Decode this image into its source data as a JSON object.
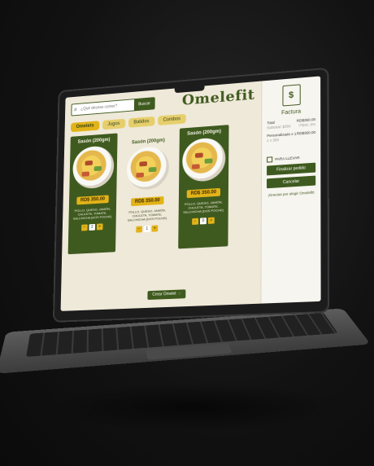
{
  "app": {
    "brand": "Omelefit"
  },
  "search": {
    "placeholder": "¿Qué deseas comer?",
    "button_label": "Buscar"
  },
  "tabs": [
    {
      "label": "Omelets",
      "active": true
    },
    {
      "label": "Jugos",
      "active": false
    },
    {
      "label": "Batidos",
      "active": false
    },
    {
      "label": "Combos",
      "active": false
    }
  ],
  "cards": [
    {
      "title": "Sasón (200gm)",
      "price": "RD$ 350.00",
      "desc": "POLLO, QUESO, JAMÓN, CHULETA, TOMATE, SALCHICHA (DOS POCHE)",
      "qty": "2"
    },
    {
      "title": "Sasón (200gm)",
      "price": "RD$ 350.00",
      "desc": "POLLO, QUESO, JAMÓN, CHULETA, TOMATE, SALCHICHA (DOS POCHE)",
      "qty": "1"
    },
    {
      "title": "Sasón (200gm)",
      "price": "RD$ 350.00",
      "desc": "POLLO, QUESO, JAMÓN, CHULETA, TOMATE, SALCHICHA (DOS POCHE)",
      "qty": "0"
    }
  ],
  "create_button": {
    "label": "Crear Omelet"
  },
  "invoice": {
    "title": "Factura",
    "total_label": "Total",
    "total_value": "RD$350.00",
    "subtotal_label": "Subtotal: $350",
    "subtotal_value": "ITBIS: 0%",
    "item_label": "Personalizado x 1",
    "item_value": "RD$350.00",
    "item_sub": "1 x 350",
    "takeaway_label": "PARA LLEVAR",
    "finish_label": "Finalizar pedido",
    "cancel_label": "Cancelar",
    "thanks": "¡Gracias por elegir Omelefit!"
  },
  "colors": {
    "primary": "#3f5a1f",
    "accent": "#e2b318",
    "background": "#efe9d9"
  }
}
